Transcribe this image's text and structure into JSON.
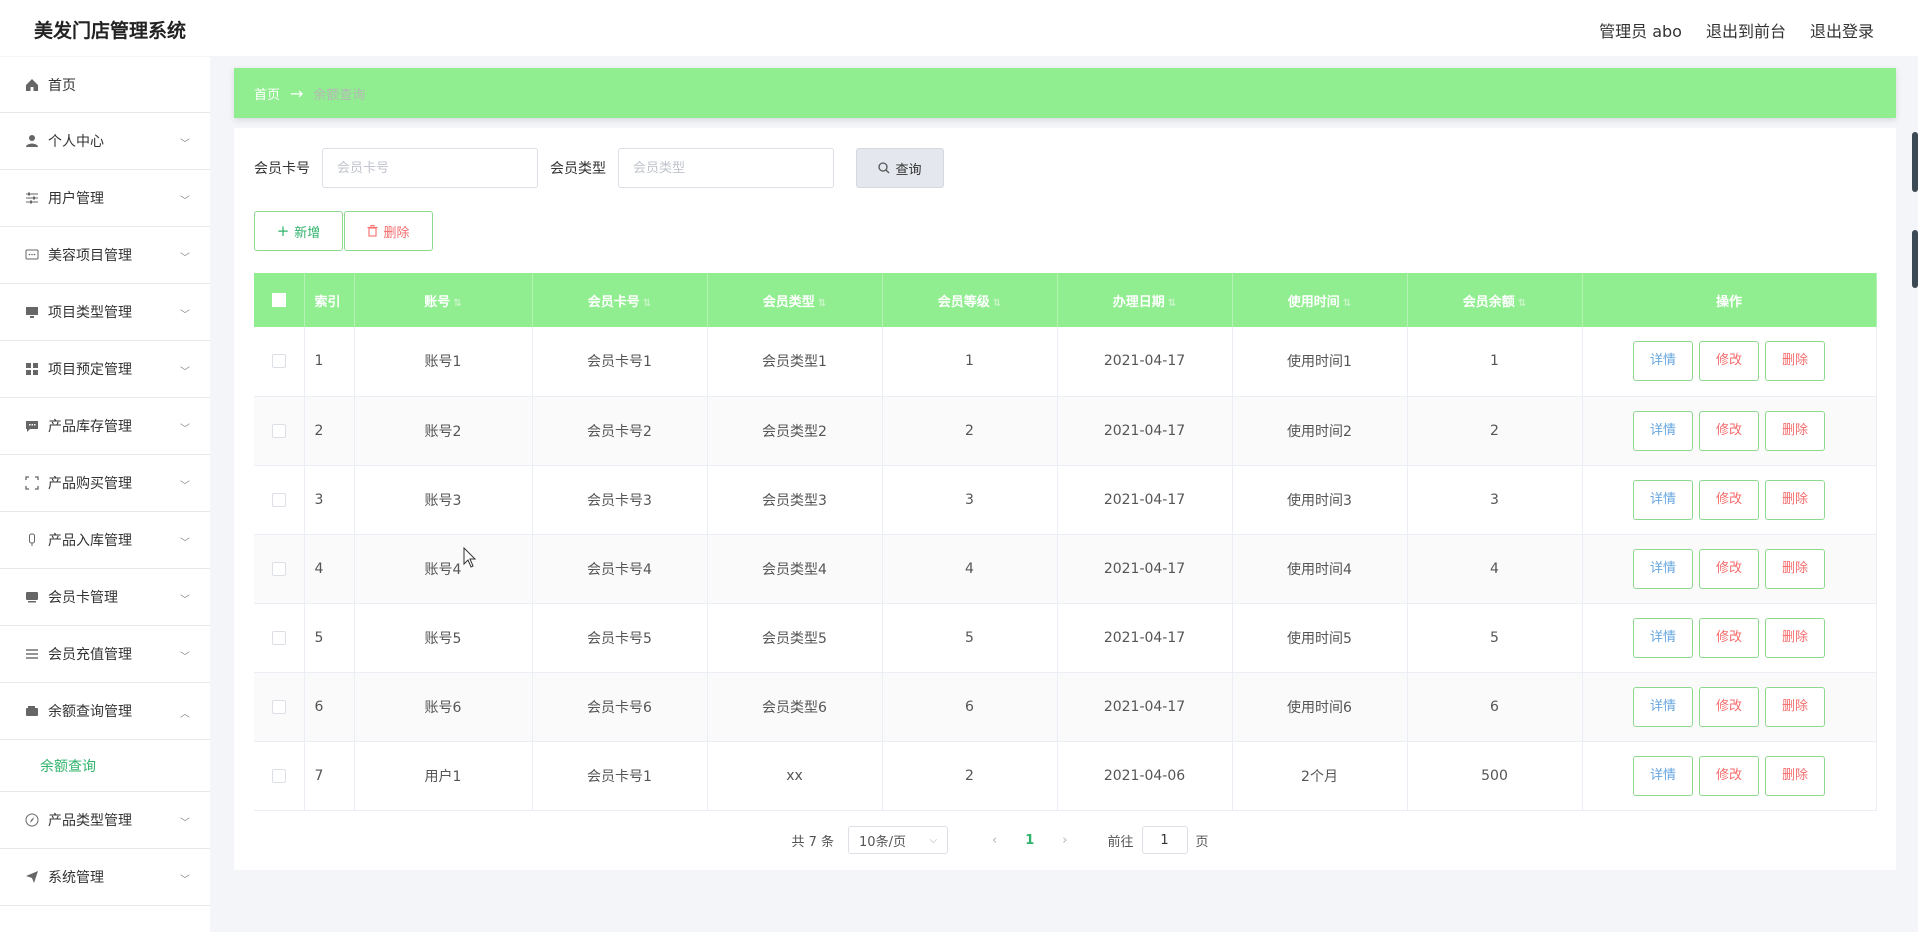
{
  "app": {
    "title": "美发门店管理系统"
  },
  "top_links": {
    "admin": "管理员 abo",
    "front": "退出到前台",
    "logout": "退出登录"
  },
  "sidebar": {
    "items": [
      {
        "label": "首页",
        "icon": "home-icon",
        "expandable": false
      },
      {
        "label": "个人中心",
        "icon": "user-icon",
        "expandable": true
      },
      {
        "label": "用户管理",
        "icon": "sliders-icon",
        "expandable": true
      },
      {
        "label": "美容项目管理",
        "icon": "chat-icon",
        "expandable": true
      },
      {
        "label": "项目类型管理",
        "icon": "monitor-icon",
        "expandable": true
      },
      {
        "label": "项目预定管理",
        "icon": "grid-icon",
        "expandable": true
      },
      {
        "label": "产品库存管理",
        "icon": "message-icon",
        "expandable": true
      },
      {
        "label": "产品购买管理",
        "icon": "fullscreen-icon",
        "expandable": true
      },
      {
        "label": "产品入库管理",
        "icon": "mic-icon",
        "expandable": true
      },
      {
        "label": "会员卡管理",
        "icon": "card-icon",
        "expandable": true
      },
      {
        "label": "会员充值管理",
        "icon": "list-icon",
        "expandable": true
      },
      {
        "label": "余额查询管理",
        "icon": "wallet-icon",
        "expandable": true,
        "expanded": true
      }
    ],
    "submenu": {
      "label": "余额查询"
    },
    "items_after": [
      {
        "label": "产品类型管理",
        "icon": "compass-icon",
        "expandable": true
      },
      {
        "label": "系统管理",
        "icon": "send-icon",
        "expandable": true
      }
    ]
  },
  "breadcrumb": {
    "home": "首页",
    "arrow": "→",
    "current": "余额查询"
  },
  "search": {
    "card_label": "会员卡号",
    "card_placeholder": "会员卡号",
    "card_value": "",
    "type_label": "会员类型",
    "type_placeholder": "会员类型",
    "type_value": "",
    "query_label": "查询"
  },
  "actions": {
    "add_label": "新增",
    "delete_label": "删除"
  },
  "table": {
    "headers": {
      "index": "索引",
      "account": "账号",
      "card_no": "会员卡号",
      "card_type": "会员类型",
      "level": "会员等级",
      "date": "办理日期",
      "use_time": "使用时间",
      "balance": "会员余额",
      "ops": "操作"
    },
    "rows": [
      {
        "index": "1",
        "account": "账号1",
        "card_no": "会员卡号1",
        "card_type": "会员类型1",
        "level": "1",
        "date": "2021-04-17",
        "use_time": "使用时间1",
        "balance": "1"
      },
      {
        "index": "2",
        "account": "账号2",
        "card_no": "会员卡号2",
        "card_type": "会员类型2",
        "level": "2",
        "date": "2021-04-17",
        "use_time": "使用时间2",
        "balance": "2"
      },
      {
        "index": "3",
        "account": "账号3",
        "card_no": "会员卡号3",
        "card_type": "会员类型3",
        "level": "3",
        "date": "2021-04-17",
        "use_time": "使用时间3",
        "balance": "3"
      },
      {
        "index": "4",
        "account": "账号4",
        "card_no": "会员卡号4",
        "card_type": "会员类型4",
        "level": "4",
        "date": "2021-04-17",
        "use_time": "使用时间4",
        "balance": "4"
      },
      {
        "index": "5",
        "account": "账号5",
        "card_no": "会员卡号5",
        "card_type": "会员类型5",
        "level": "5",
        "date": "2021-04-17",
        "use_time": "使用时间5",
        "balance": "5"
      },
      {
        "index": "6",
        "account": "账号6",
        "card_no": "会员卡号6",
        "card_type": "会员类型6",
        "level": "6",
        "date": "2021-04-17",
        "use_time": "使用时间6",
        "balance": "6"
      },
      {
        "index": "7",
        "account": "用户1",
        "card_no": "会员卡号1",
        "card_type": "xx",
        "level": "2",
        "date": "2021-04-06",
        "use_time": "2个月",
        "balance": "500"
      }
    ],
    "op_labels": {
      "detail": "详情",
      "edit": "修改",
      "delete": "删除"
    }
  },
  "pagination": {
    "total": "共 7 条",
    "page_size": "10条/页",
    "current_page": "1",
    "goto_prefix": "前往",
    "goto_value": "1",
    "goto_suffix": "页"
  },
  "colors": {
    "accent": "#90ee90",
    "accent_text": "#2fb36b",
    "danger": "#f56c6c"
  }
}
